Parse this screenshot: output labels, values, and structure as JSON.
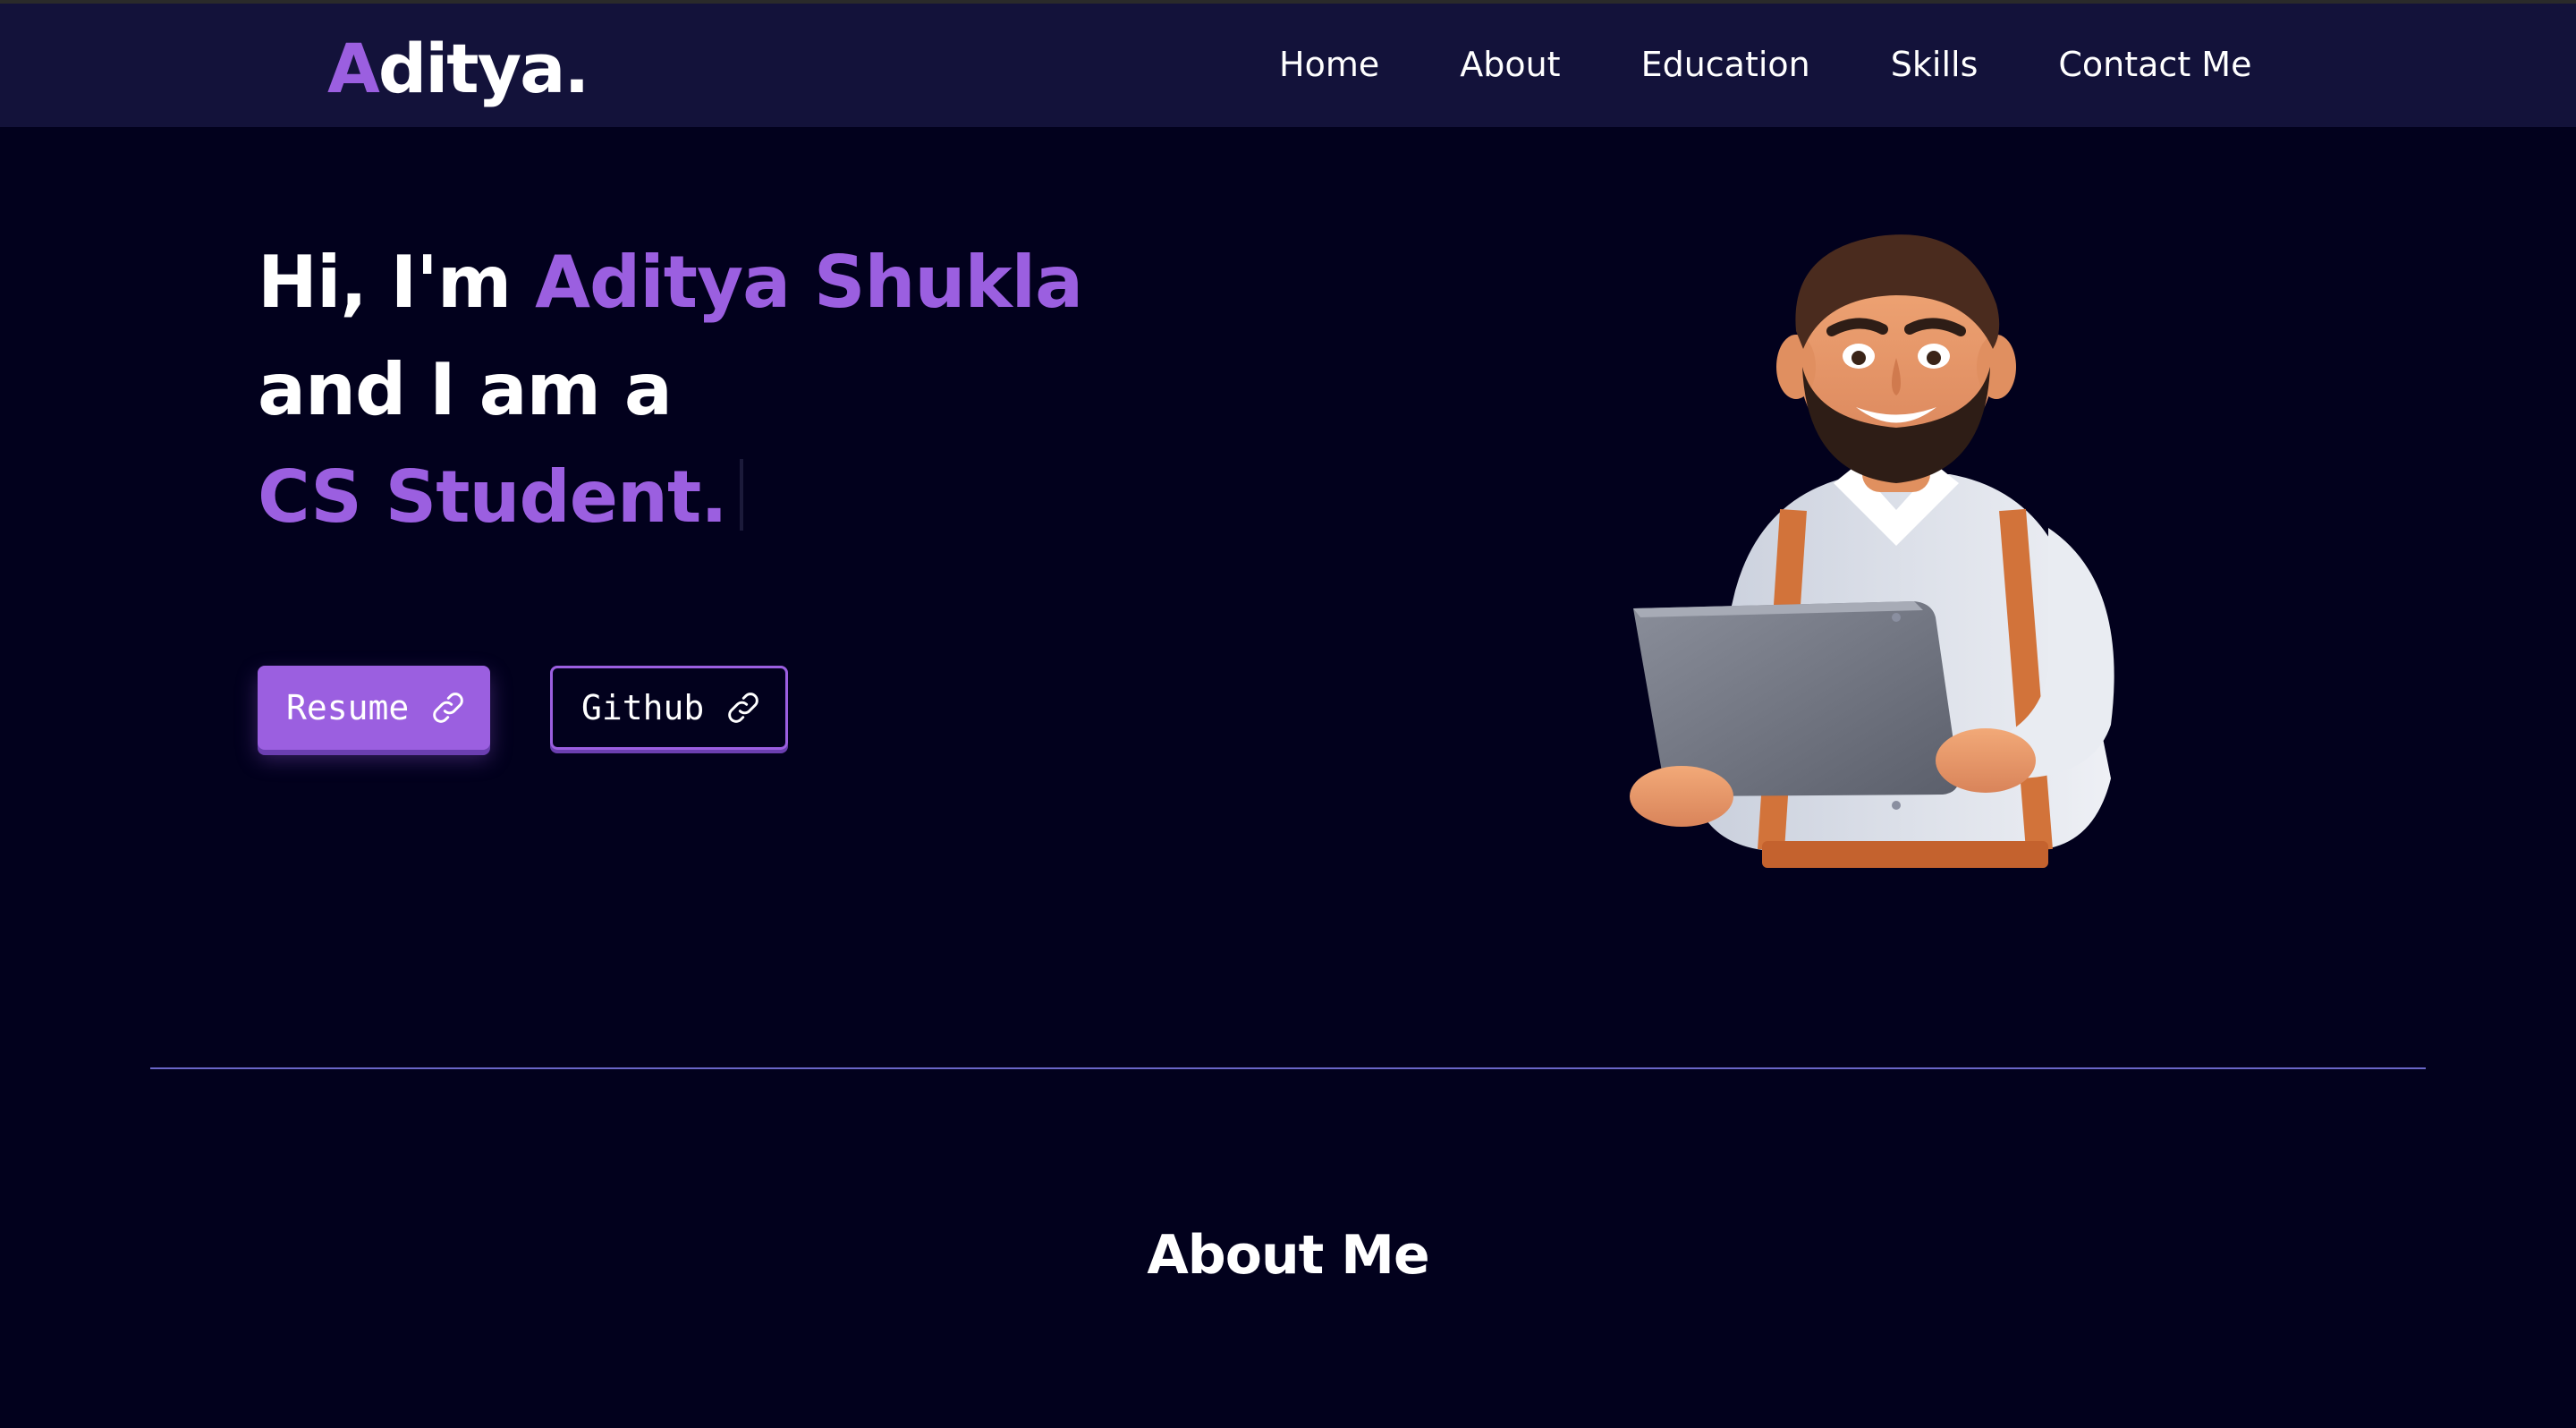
{
  "brand": {
    "first_letter": "A",
    "rest": "ditya."
  },
  "nav": {
    "items": [
      {
        "label": "Home"
      },
      {
        "label": "About"
      },
      {
        "label": "Education"
      },
      {
        "label": "Skills"
      },
      {
        "label": "Contact Me"
      }
    ]
  },
  "hero": {
    "greeting": "Hi, I'm ",
    "name": "Aditya Shukla",
    "line2": "and I am a",
    "role": "CS Student."
  },
  "buttons": {
    "resume": "Resume",
    "github": "Github"
  },
  "about": {
    "title": "About Me"
  },
  "colors": {
    "background": "#02011d",
    "navbar": "#13123a",
    "accent": "#9b5fe0",
    "divider": "#6a66c8"
  },
  "icons": {
    "link": "link-icon",
    "avatar": "developer-avatar-illustration"
  }
}
